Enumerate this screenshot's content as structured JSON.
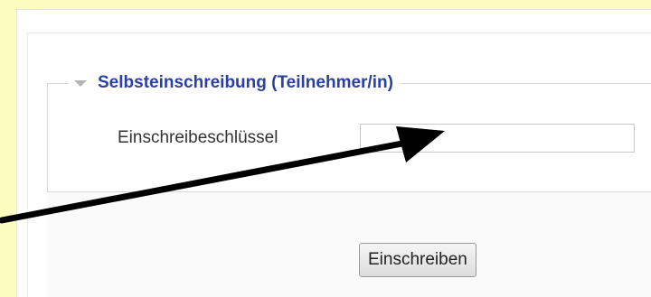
{
  "enrolment": {
    "section_title": "Selbsteinschreibung (Teilnehmer/in)",
    "key_label": "Einschreibeschlüssel",
    "key_value": "",
    "submit_label": "Einschreiben"
  },
  "icons": {
    "legend_toggle": "triangle-down-icon",
    "annotation": "arrow-annotation-icon"
  },
  "colors": {
    "page_background": "#fbfcbf",
    "legend_text": "#2a3fa8",
    "annotation_arrow": "#000000"
  }
}
